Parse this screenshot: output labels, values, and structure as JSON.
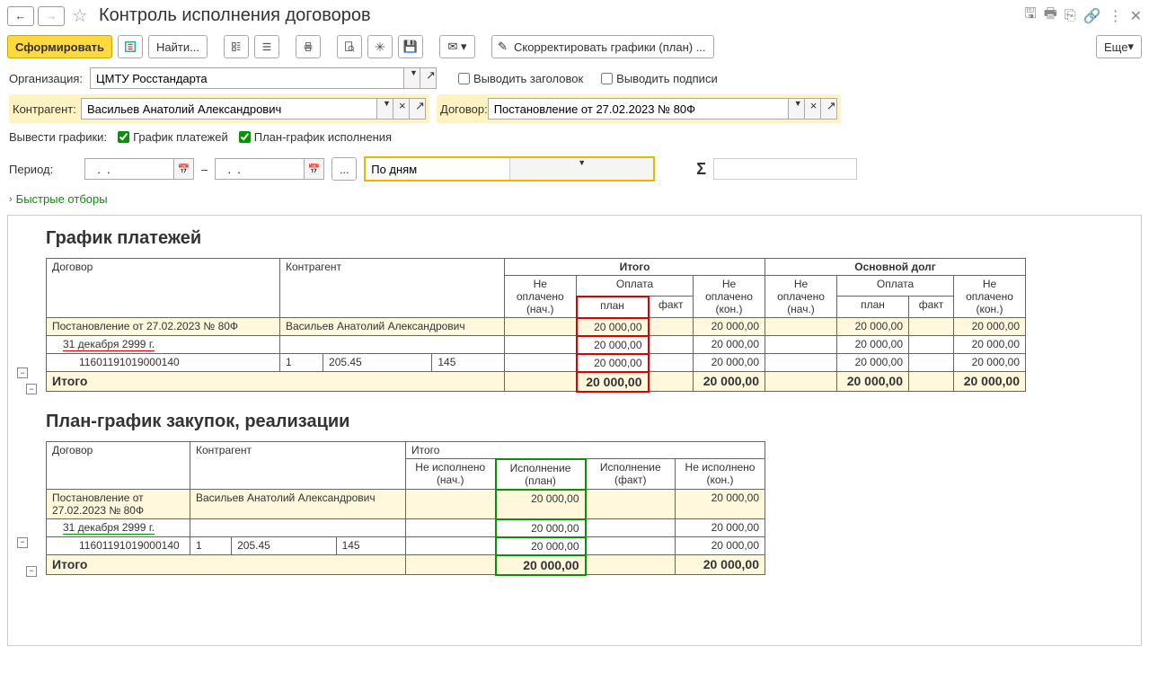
{
  "header": {
    "title": "Контроль исполнения договоров",
    "more_btn": "Еще"
  },
  "toolbar": {
    "generate": "Сформировать",
    "find": "Найти...",
    "correct": "Скорректировать графики (план) ..."
  },
  "filters": {
    "org_label": "Организация:",
    "org_value": "ЦМТУ Росстандарта",
    "show_header": "Выводить заголовок",
    "show_sign": "Выводить подписи",
    "contr_label": "Контрагент:",
    "contr_value": "Васильев Анатолий Александрович",
    "dog_label": "Договор:",
    "dog_value": "Постановление от 27.02.2023 № 80Ф",
    "graphs_label": "Вывести графики:",
    "g_pay": "График платежей",
    "g_plan": "План-график исполнения",
    "period_label": "Период:",
    "date_from": "  .  .    ",
    "date_to": "  .  .    ",
    "ellipsis": "...",
    "by_days": "По дням",
    "quick": "Быстрые отборы"
  },
  "report1": {
    "title": "График платежей",
    "h_dog": "Договор",
    "h_contr": "Контрагент",
    "h_total": "Итого",
    "h_main": "Основной долг",
    "h_np_start": "Не оплачено (нач.)",
    "h_pay": "Оплата",
    "h_plan": "план",
    "h_fact": "факт",
    "h_np_end": "Не оплачено (кон.)",
    "r1_dog": "Постановление от 27.02.2023 № 80Ф",
    "r1_contr": "Васильев Анатолий Александрович",
    "r2_date": "31 декабря 2999 г.",
    "r3_code": "11601191019000140",
    "r3_c1": "1",
    "r3_c2": "205.45",
    "r3_c3": "145",
    "v_plan": "20 000,00",
    "v_end": "20 000,00",
    "total_label": "Итого",
    "total_plan": "20 000,00",
    "total_end": "20 000,00"
  },
  "report2": {
    "title": "План-график закупок, реализации",
    "h_dog": "Договор",
    "h_contr": "Контрагент",
    "h_total": "Итого",
    "h_ni_start": "Не исполнено (нач.)",
    "h_plan": "Исполнение (план)",
    "h_fact": "Исполнение (факт)",
    "h_ni_end": "Не исполнено (кон.)",
    "r1_dog": "Постановление от 27.02.2023 № 80Ф",
    "r1_contr": "Васильев Анатолий Александрович",
    "r2_date": "31 декабря 2999 г.",
    "r3_code": "11601191019000140",
    "r3_c1": "1",
    "r3_c2": "205.45",
    "r3_c3": "145",
    "v_plan": "20 000,00",
    "v_end": "20 000,00",
    "total_label": "Итого",
    "total_plan": "20 000,00",
    "total_end": "20 000,00"
  }
}
